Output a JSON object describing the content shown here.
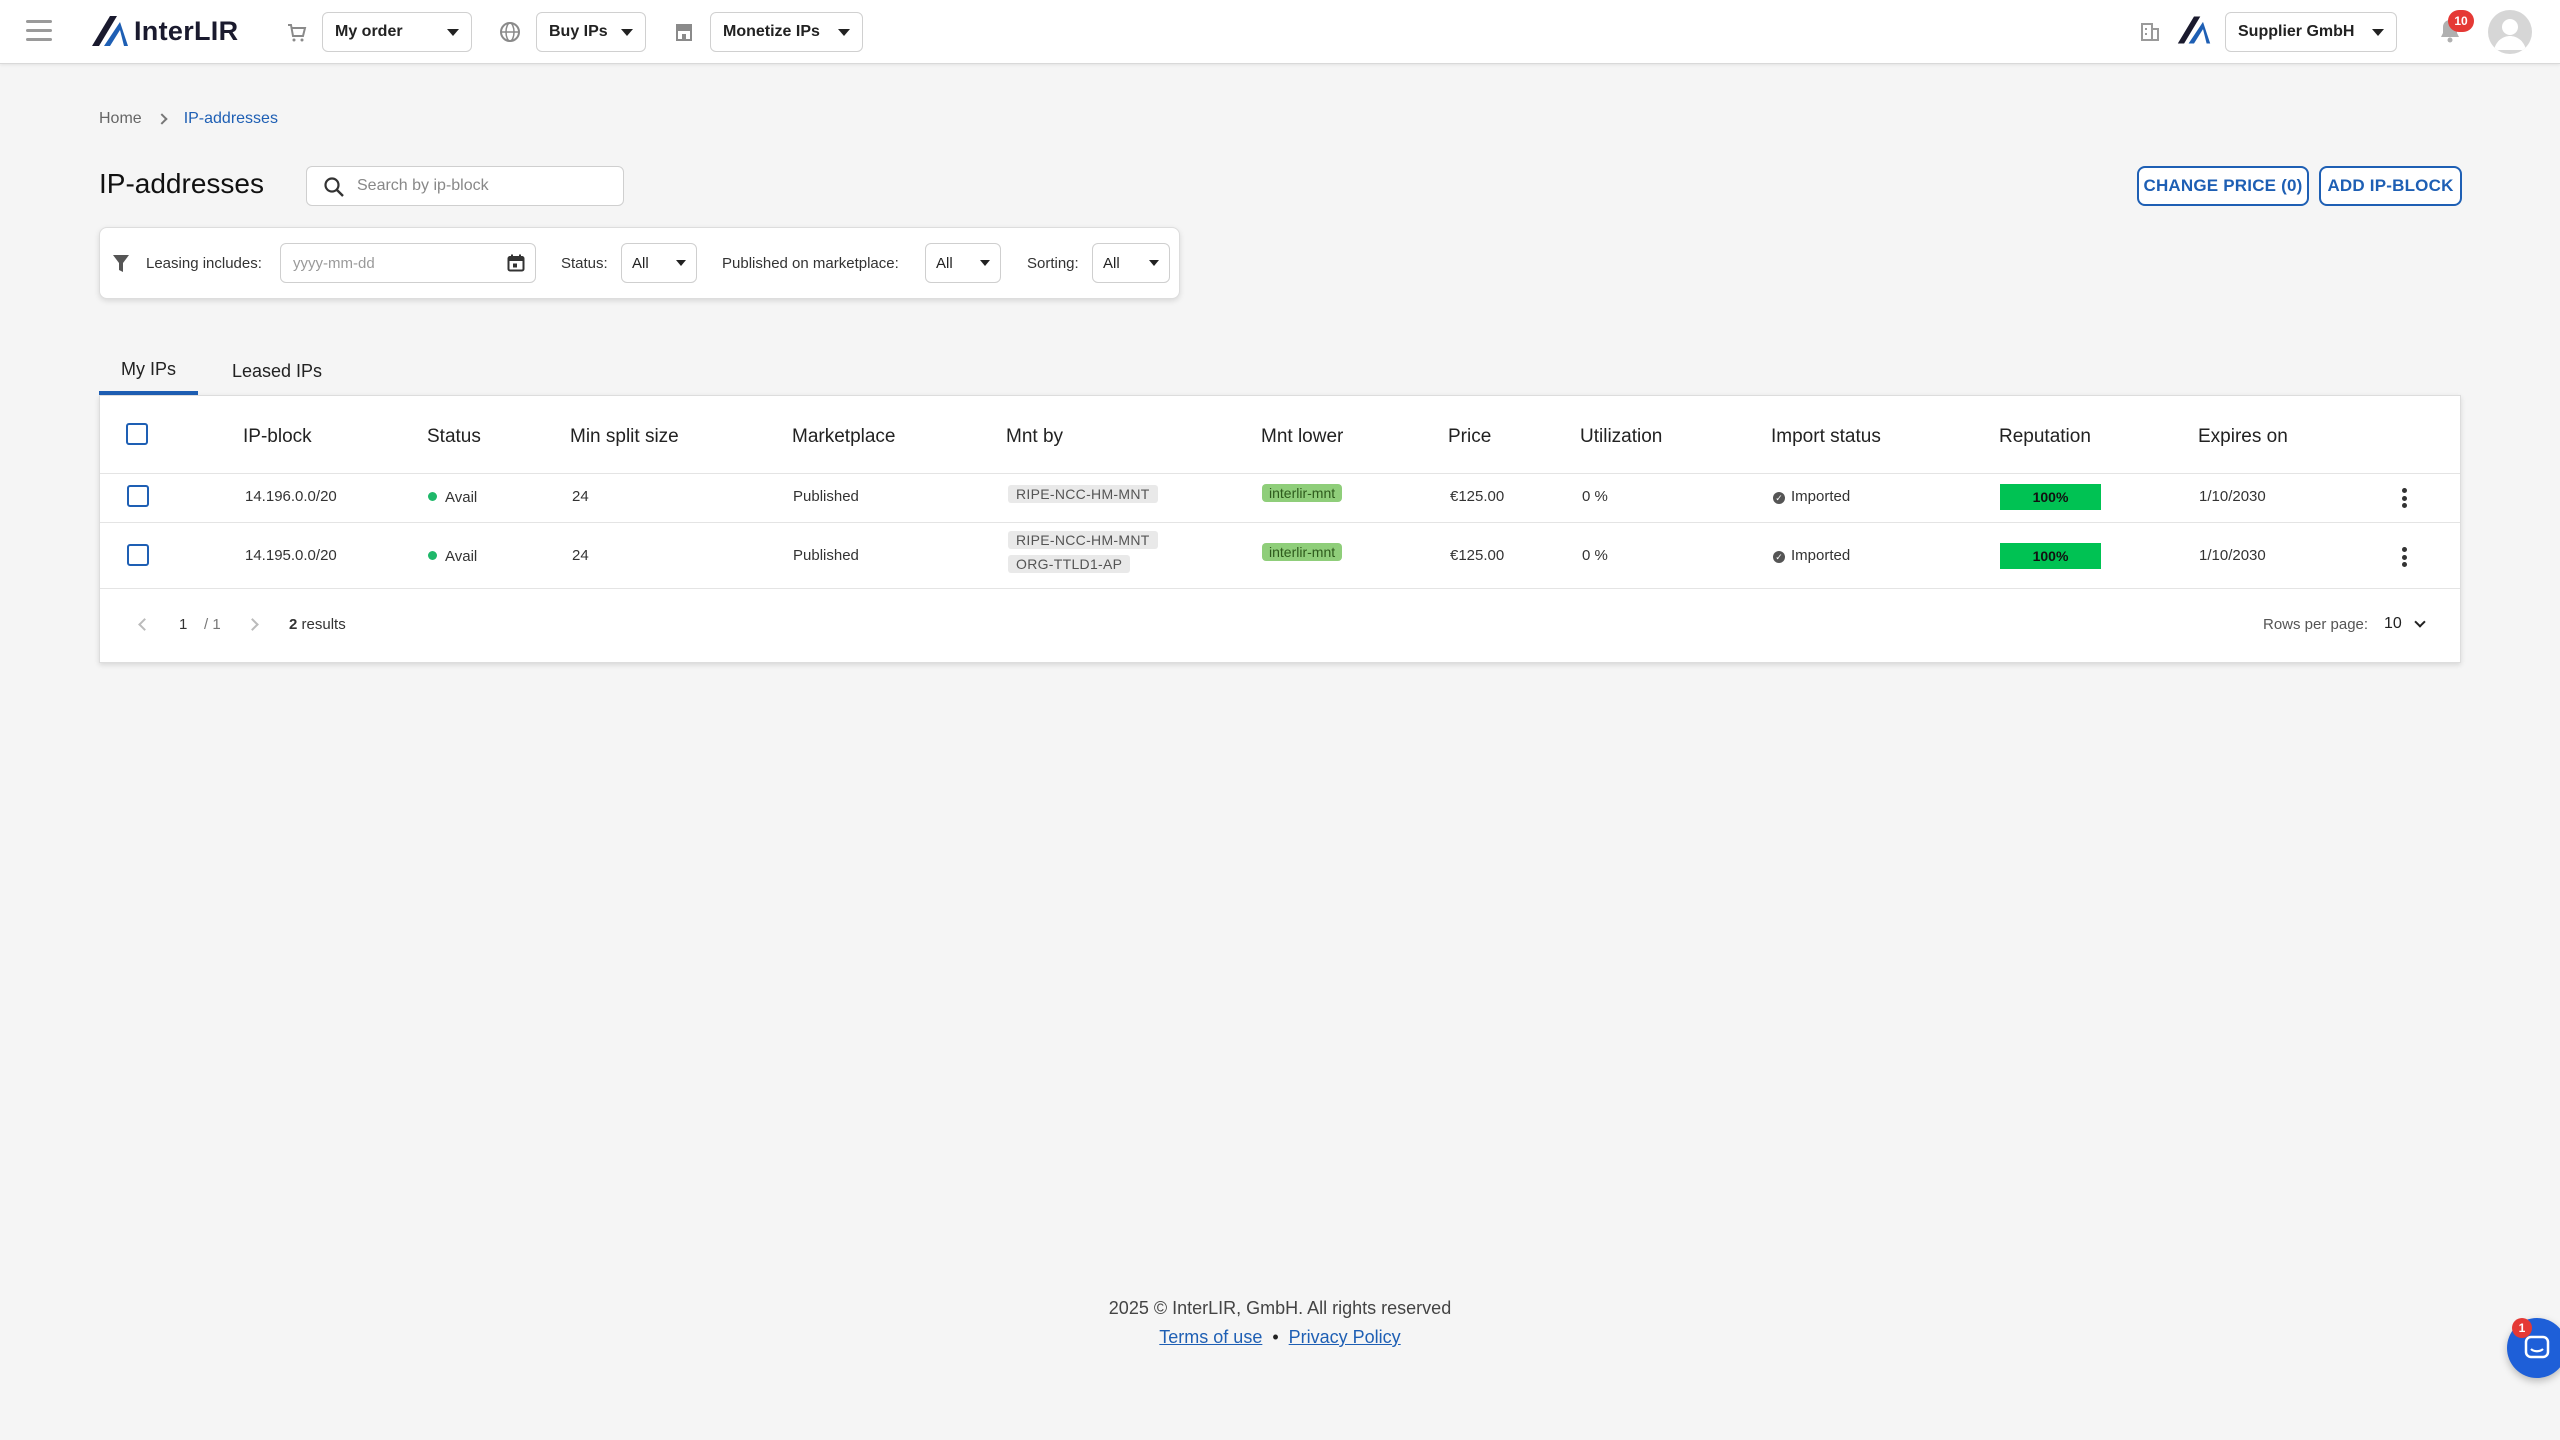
{
  "header": {
    "menu_icon": "hamburger-icon",
    "logo_text": "InterLIR",
    "nav": [
      {
        "icon": "cart-icon",
        "label": "My order"
      },
      {
        "icon": "globe-icon",
        "label": "Buy IPs"
      },
      {
        "icon": "store-icon",
        "label": "Monetize IPs"
      }
    ],
    "company_icon": "building-icon",
    "company": "Supplier GmbH",
    "notifications_count": "10",
    "avatar_icon": "user-avatar-icon"
  },
  "breadcrumb": {
    "home": "Home",
    "current": "IP-addresses"
  },
  "page": {
    "title": "IP-addresses",
    "search_placeholder": "Search by ip-block",
    "change_price_label": "CHANGE PRICE (0)",
    "add_block_label": "ADD IP-BLOCK"
  },
  "filters": {
    "leasing_label": "Leasing includes:",
    "date_placeholder": "yyyy-mm-dd",
    "status_label": "Status:",
    "status_value": "All",
    "marketplace_label": "Published on marketplace:",
    "marketplace_value": "All",
    "sorting_label": "Sorting:",
    "sorting_value": "All"
  },
  "tabs": [
    {
      "label": "My IPs",
      "active": true
    },
    {
      "label": "Leased IPs",
      "active": false
    }
  ],
  "table": {
    "columns": [
      "IP-block",
      "Status",
      "Min split size",
      "Marketplace",
      "Mnt by",
      "Mnt lower",
      "Price",
      "Utilization",
      "Import status",
      "Reputation",
      "Expires on"
    ],
    "rows": [
      {
        "ip_block": "14.196.0.0/20",
        "status": "Avail",
        "min_split": "24",
        "marketplace": "Published",
        "mnt_by": [
          "RIPE-NCC-HM-MNT"
        ],
        "mnt_lower": "interlir-mnt",
        "price": "€125.00",
        "utilization": "0 %",
        "import_status": "Imported",
        "reputation": "100%",
        "expires_on": "1/10/2030"
      },
      {
        "ip_block": "14.195.0.0/20",
        "status": "Avail",
        "min_split": "24",
        "marketplace": "Published",
        "mnt_by": [
          "RIPE-NCC-HM-MNT",
          "ORG-TTLD1-AP"
        ],
        "mnt_lower": "interlir-mnt",
        "price": "€125.00",
        "utilization": "0 %",
        "import_status": "Imported",
        "reputation": "100%",
        "expires_on": "1/10/2030"
      }
    ],
    "pagination": {
      "page": "1",
      "of": "/ 1",
      "results_count": "2",
      "results_label": "results",
      "rows_per_page_label": "Rows per page:",
      "rows_per_page": "10"
    }
  },
  "colors": {
    "accent": "#1e5fb4",
    "status_avail": "#1fb86a",
    "reputation": "#00c253",
    "tag_green": "#8fce7a"
  },
  "footer": {
    "copyright": "2025 © InterLIR, GmbH. All rights reserved",
    "terms": "Terms of use",
    "bullet": "•",
    "privacy": "Privacy Policy"
  },
  "chat": {
    "icon": "chat-icon",
    "badge": "1"
  }
}
